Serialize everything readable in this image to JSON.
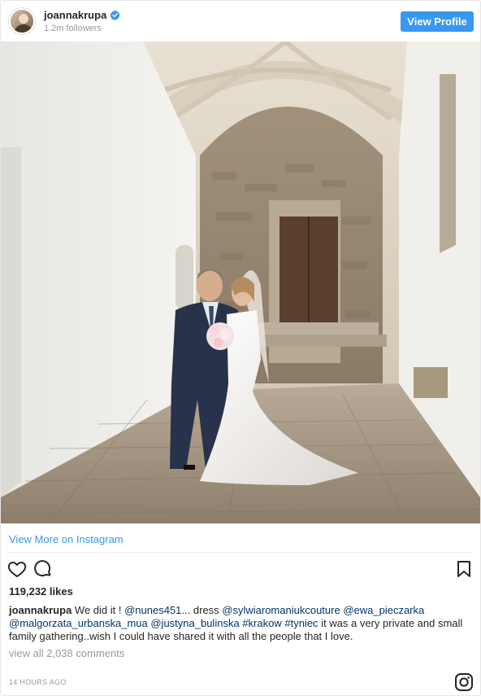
{
  "header": {
    "username": "joannakrupa",
    "followers": "1.2m followers",
    "view_profile_label": "View Profile",
    "verified_icon": "verified-badge-icon",
    "accent_color": "#3897f0"
  },
  "post": {
    "photo_icon": "wedding-photo",
    "view_more_label": "View More on Instagram",
    "likes": "119,232 likes",
    "caption_user": "joannakrupa",
    "caption_parts": [
      {
        "t": "We did it ! ",
        "link": false
      },
      {
        "t": "@nunes451",
        "link": true
      },
      {
        "t": "... dress ",
        "link": false
      },
      {
        "t": "@sylwiaromaniukcouture",
        "link": true
      },
      {
        "t": " ",
        "link": false
      },
      {
        "t": "@ewa_pieczarka",
        "link": true
      },
      {
        "t": " ",
        "link": false
      },
      {
        "t": "@malgorzata_urbanska_mua",
        "link": true
      },
      {
        "t": " ",
        "link": false
      },
      {
        "t": "@justyna_bulinska",
        "link": true
      },
      {
        "t": " ",
        "link": false
      },
      {
        "t": "#krakow",
        "link": true
      },
      {
        "t": " ",
        "link": false
      },
      {
        "t": "#tyniec",
        "link": true
      },
      {
        "t": " it was a very private and small family gathering..wish I could have shared it with all the people that I love.",
        "link": false
      }
    ],
    "view_comments": "view all 2,038 comments",
    "timestamp": "14 HOURS AGO"
  }
}
